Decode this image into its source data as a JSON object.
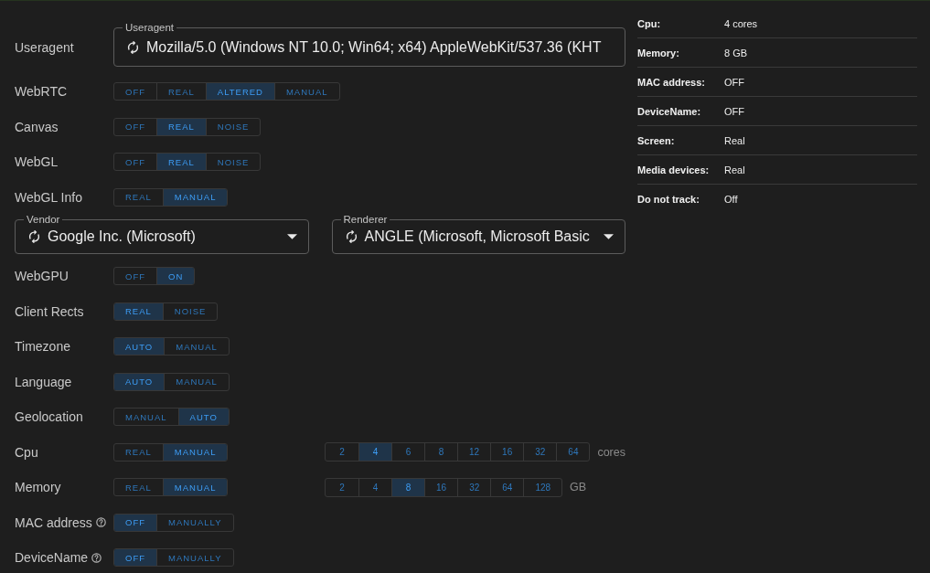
{
  "settings": [
    {
      "kind": "text_field",
      "label": "Useragent",
      "legend": "Useragent",
      "value": "Mozilla/5.0 (Windows NT 10.0; Win64; x64) AppleWebKit/537.36 (KHT"
    },
    {
      "kind": "toggle",
      "label": "WebRTC",
      "help": false,
      "options": [
        {
          "label": "OFF",
          "selected": false
        },
        {
          "label": "REAL",
          "selected": false
        },
        {
          "label": "ALTERED",
          "selected": true
        },
        {
          "label": "MANUAL",
          "selected": false
        }
      ]
    },
    {
      "kind": "toggle",
      "label": "Canvas",
      "help": false,
      "options": [
        {
          "label": "OFF",
          "selected": false
        },
        {
          "label": "REAL",
          "selected": true
        },
        {
          "label": "NOISE",
          "selected": false
        }
      ]
    },
    {
      "kind": "toggle",
      "label": "WebGL",
      "help": false,
      "options": [
        {
          "label": "OFF",
          "selected": false
        },
        {
          "label": "REAL",
          "selected": true
        },
        {
          "label": "NOISE",
          "selected": false
        }
      ]
    },
    {
      "kind": "toggle",
      "label": "WebGL Info",
      "help": false,
      "options": [
        {
          "label": "REAL",
          "selected": false
        },
        {
          "label": "MANUAL",
          "selected": true
        }
      ]
    },
    {
      "kind": "select_pair",
      "fields": [
        {
          "legend": "Vendor",
          "value": "Google Inc. (Microsoft)"
        },
        {
          "legend": "Renderer",
          "value": "ANGLE (Microsoft, Microsoft Basic"
        }
      ]
    },
    {
      "kind": "toggle",
      "label": "WebGPU",
      "help": false,
      "options": [
        {
          "label": "OFF",
          "selected": false
        },
        {
          "label": "ON",
          "selected": true
        }
      ]
    },
    {
      "kind": "toggle",
      "label": "Client Rects",
      "help": false,
      "options": [
        {
          "label": "REAL",
          "selected": true
        },
        {
          "label": "NOISE",
          "selected": false
        }
      ]
    },
    {
      "kind": "toggle",
      "label": "Timezone",
      "help": false,
      "options": [
        {
          "label": "AUTO",
          "selected": true
        },
        {
          "label": "MANUAL",
          "selected": false
        }
      ]
    },
    {
      "kind": "toggle",
      "label": "Language",
      "help": false,
      "options": [
        {
          "label": "AUTO",
          "selected": true
        },
        {
          "label": "MANUAL",
          "selected": false
        }
      ]
    },
    {
      "kind": "toggle",
      "label": "Geolocation",
      "help": false,
      "options": [
        {
          "label": "MANUAL",
          "selected": false
        },
        {
          "label": "AUTO",
          "selected": true
        }
      ]
    },
    {
      "kind": "toggle",
      "label": "Cpu",
      "help": false,
      "options": [
        {
          "label": "REAL",
          "selected": false
        },
        {
          "label": "MANUAL",
          "selected": true
        }
      ],
      "choices": [
        {
          "label": "2",
          "selected": false
        },
        {
          "label": "4",
          "selected": true
        },
        {
          "label": "6",
          "selected": false
        },
        {
          "label": "8",
          "selected": false
        },
        {
          "label": "12",
          "selected": false
        },
        {
          "label": "16",
          "selected": false
        },
        {
          "label": "32",
          "selected": false
        },
        {
          "label": "64",
          "selected": false
        }
      ],
      "unit": "cores"
    },
    {
      "kind": "toggle",
      "label": "Memory",
      "help": false,
      "options": [
        {
          "label": "REAL",
          "selected": false
        },
        {
          "label": "MANUAL",
          "selected": true
        }
      ],
      "choices": [
        {
          "label": "2",
          "selected": false
        },
        {
          "label": "4",
          "selected": false
        },
        {
          "label": "8",
          "selected": true
        },
        {
          "label": "16",
          "selected": false
        },
        {
          "label": "32",
          "selected": false
        },
        {
          "label": "64",
          "selected": false
        },
        {
          "label": "128",
          "selected": false
        }
      ],
      "unit": "GB"
    },
    {
      "kind": "toggle",
      "label": "MAC address",
      "help": true,
      "options": [
        {
          "label": "OFF",
          "selected": true
        },
        {
          "label": "MANUALLY",
          "selected": false
        }
      ]
    },
    {
      "kind": "toggle",
      "label": "DeviceName",
      "help": true,
      "options": [
        {
          "label": "OFF",
          "selected": true
        },
        {
          "label": "MANUALLY",
          "selected": false
        }
      ]
    }
  ],
  "summary": [
    {
      "label": "Cpu:",
      "value": "4 cores"
    },
    {
      "label": "Memory:",
      "value": "8 GB"
    },
    {
      "label": "MAC address:",
      "value": "OFF"
    },
    {
      "label": "DeviceName:",
      "value": "OFF"
    },
    {
      "label": "Screen:",
      "value": "Real"
    },
    {
      "label": "Media devices:",
      "value": "Real"
    },
    {
      "label": "Do not track:",
      "value": "Off"
    }
  ]
}
